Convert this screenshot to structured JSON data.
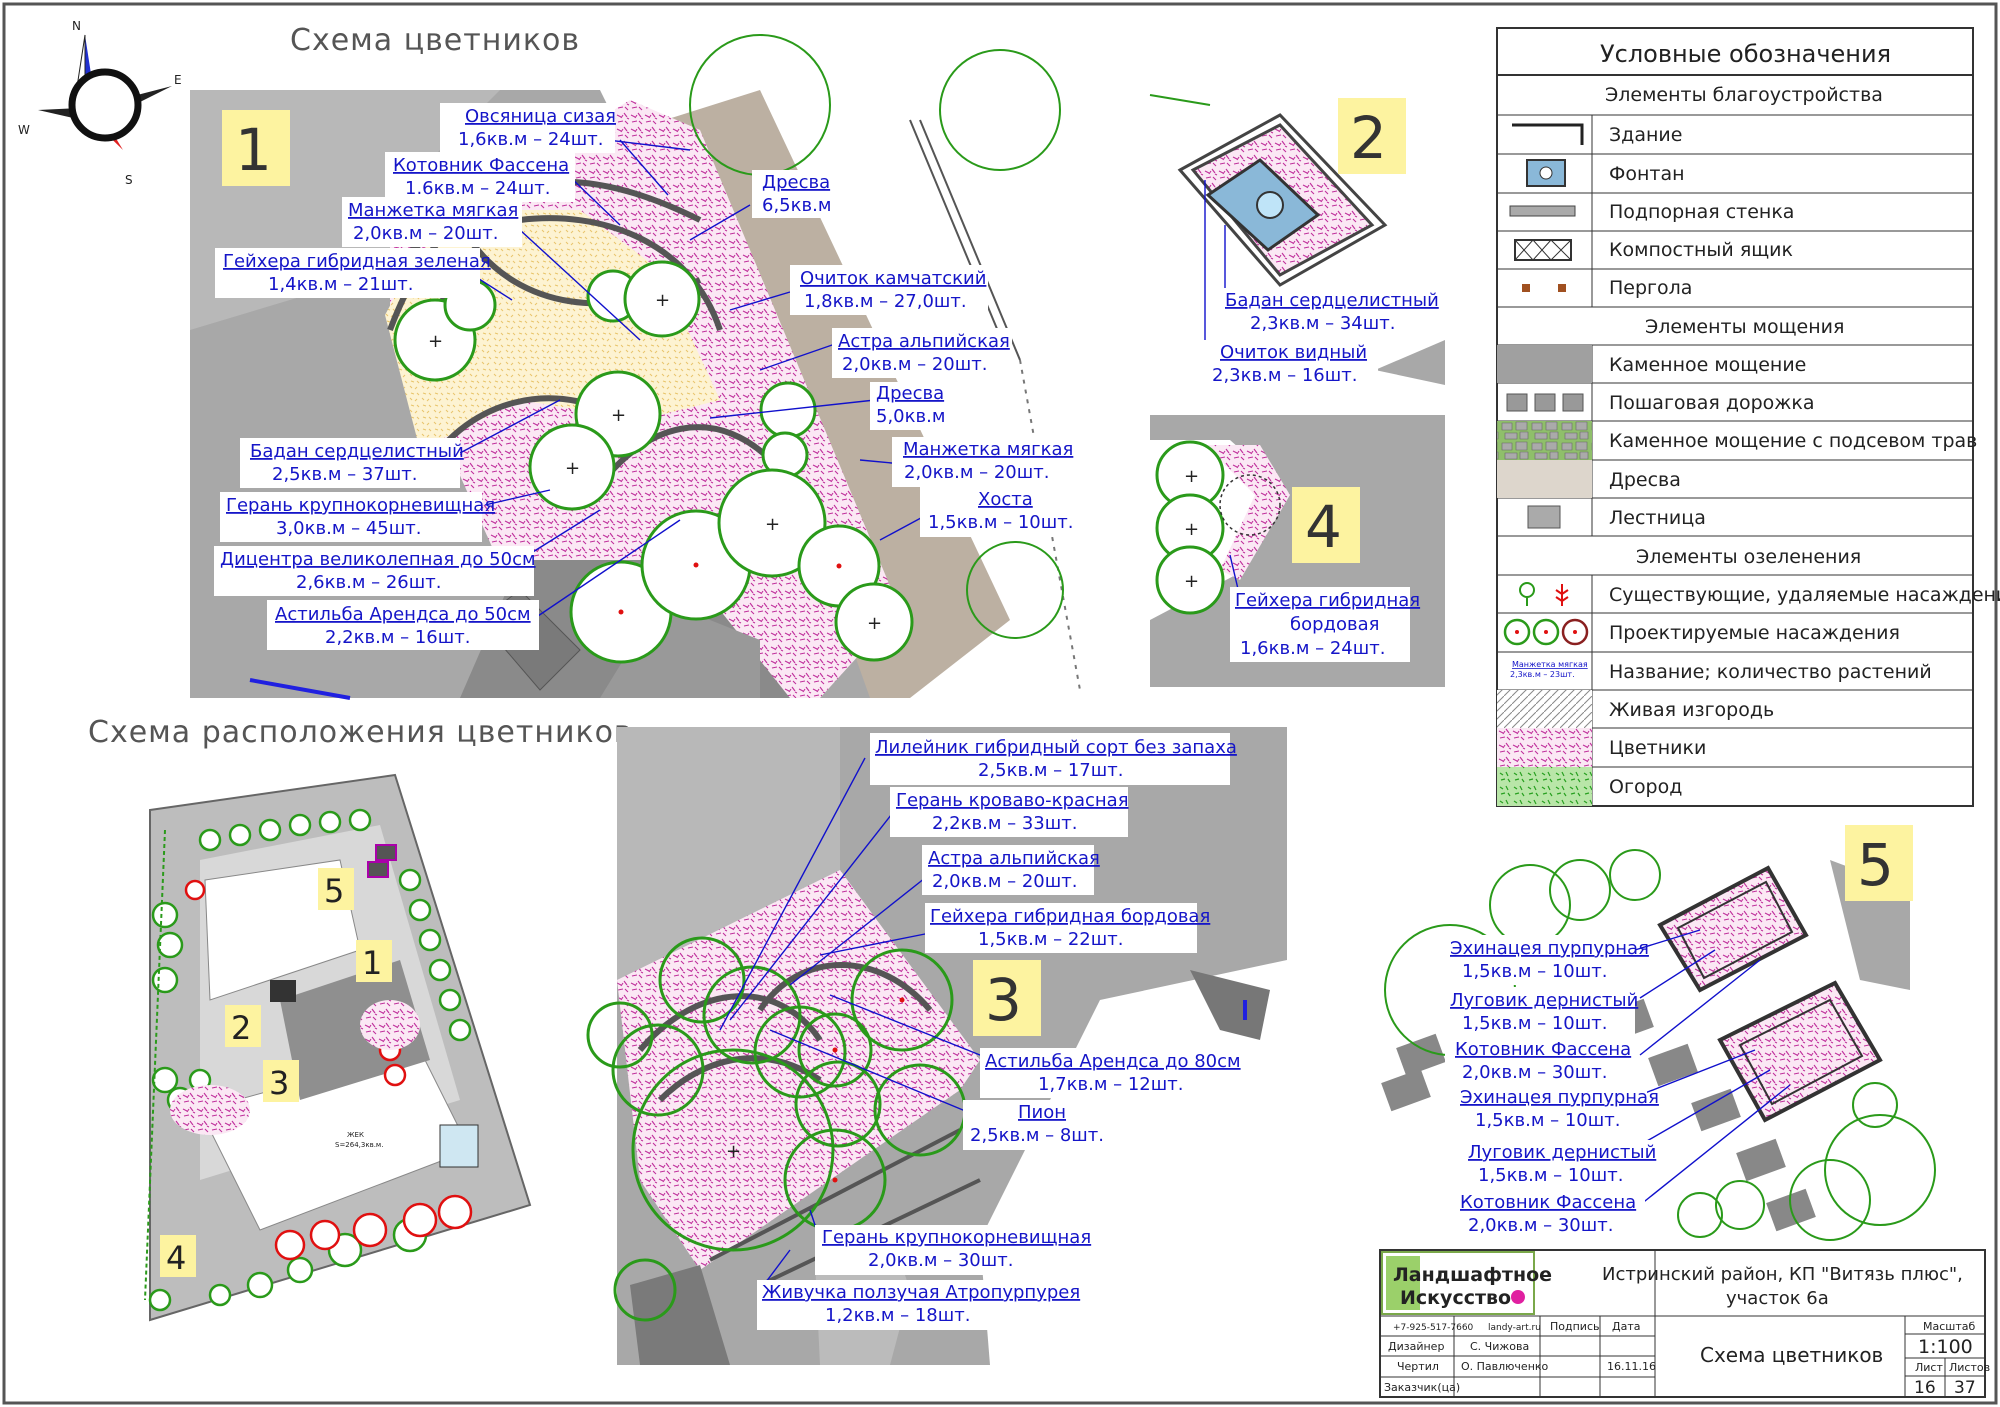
{
  "headings": {
    "scheme": "Схема цветников",
    "layout": "Схема расположения цветников"
  },
  "compass": {
    "n": "N",
    "e": "E",
    "s": "S",
    "w": "W"
  },
  "sections": [
    "1",
    "2",
    "3",
    "4",
    "5"
  ],
  "layout_numbers": [
    "5",
    "1",
    "2",
    "3",
    "4"
  ],
  "bed1_labels": [
    {
      "name": "Овсяница сизая",
      "qty": "1,6кв.м – 24шт."
    },
    {
      "name": "Котовник Фассена",
      "qty": "1.6кв.м – 24шт."
    },
    {
      "name": "Манжетка мягкая",
      "qty": "2,0кв.м – 20шт."
    },
    {
      "name": "Гейхера гибридная зеленая",
      "qty": "1,4кв.м – 21шт."
    },
    {
      "name": "Дресва",
      "qty": "6,5кв.м"
    },
    {
      "name": "Очиток камчатский",
      "qty": "1,8кв.м – 27,0шт."
    },
    {
      "name": "Астра альпийская",
      "qty": "2,0кв.м – 20шт."
    },
    {
      "name": "Дресва",
      "qty": "5,0кв.м"
    },
    {
      "name": "Бадан сердцелистный",
      "qty": "2,5кв.м – 37шт."
    },
    {
      "name": "Манжетка мягкая",
      "qty": "2,0кв.м – 20шт."
    },
    {
      "name": "Герань крупнокорневищная",
      "qty": "3,0кв.м – 45шт."
    },
    {
      "name": "Хоста",
      "qty": "1,5кв.м – 10шт."
    },
    {
      "name": "Дицентра великолепная до 50см",
      "qty": "2,6кв.м – 26шт."
    },
    {
      "name": "Астильба Арендса до 50см",
      "qty": "2,2кв.м – 16шт."
    }
  ],
  "bed2_labels": [
    {
      "name": "Бадан сердцелистный",
      "qty": "2,3кв.м – 34шт."
    },
    {
      "name": "Очиток видный",
      "qty": "2,3кв.м – 16шт."
    }
  ],
  "bed4_label": {
    "line1": "Гейхера гибридная",
    "line2": "бордовая",
    "qty": "1,6кв.м – 24шт."
  },
  "bed3_labels": [
    {
      "name": "Лилейник гибридный сорт без запаха",
      "qty": "2,5кв.м – 17шт."
    },
    {
      "name": "Герань кроваво-красная",
      "qty": "2,2кв.м – 33шт."
    },
    {
      "name": "Астра альпийская",
      "qty": "2,0кв.м – 20шт."
    },
    {
      "name": "Гейхера гибридная бордовая",
      "qty": "1,5кв.м – 22шт."
    },
    {
      "name": "Астильба Арендса до 80см",
      "qty": "1,7кв.м – 12шт."
    },
    {
      "name": "Пион",
      "qty": "2,5кв.м – 8шт."
    },
    {
      "name": "Герань крупнокорневищная",
      "qty": "2,0кв.м – 30шт."
    },
    {
      "name": "Живучка ползучая Атропурпурея",
      "qty": "1,2кв.м – 18шт."
    }
  ],
  "bed5_labels": [
    {
      "name": "Эхинацея пурпурная",
      "qty": "1,5кв.м – 10шт."
    },
    {
      "name": "Луговик дернистый",
      "qty": "1,5кв.м – 10шт."
    },
    {
      "name": "Котовник Фассена",
      "qty": "2,0кв.м – 30шт."
    },
    {
      "name": "Эхинацея пурпурная",
      "qty": "1,5кв.м – 10шт."
    },
    {
      "name": "Луговик дернистый",
      "qty": "1,5кв.м – 10шт."
    },
    {
      "name": "Котовник Фассена",
      "qty": "2,0кв.м – 30шт."
    }
  ],
  "legend": {
    "title": "Условные обозначения",
    "groups": [
      {
        "header": "Элементы благоустройства",
        "items": [
          "Здание",
          "Фонтан",
          "Подпорная стенка",
          "Компостный ящик",
          "Пергола"
        ]
      },
      {
        "header": "Элементы мощения",
        "items": [
          "Каменное мощение",
          "Пошаговая дорожка",
          "Каменное мощение с подсевом трав",
          "Дресва",
          "Лестница"
        ]
      },
      {
        "header": "Элементы озеленения",
        "items": [
          "Существующие, удаляемые насаждения",
          "Проектируемые насаждения",
          "Название; количество растений",
          "Живая изгородь",
          "Цветники",
          "Огород"
        ]
      }
    ],
    "sample_name": "Манжетка мягкая",
    "sample_qty": "2,3кв.м – 23шт."
  },
  "site_plan": {
    "building": "ЖЕК",
    "area": "S=264,3кв.м."
  },
  "title_block": {
    "logo_line1": "Ландшафтное",
    "logo_line2": "Искусство",
    "phone": "+7-925-517-7660",
    "site": "landy-art.ru",
    "signature": "Подпись",
    "date_label": "Дата",
    "project": "Истринский район, КП \"Витязь плюс\",",
    "plot": "участок 6а",
    "designer_role": "Дизайнер",
    "designer": "С. Чижова",
    "drafter_role": "Чертил",
    "drafter": "О. Павлюченко",
    "date": "16.11.16",
    "client_role": "Заказчик(ца)",
    "sheet_title": "Схема цветников",
    "scale_label": "Масштаб",
    "scale": "1:100",
    "sheet_label": "Лист",
    "sheets_label": "Листов",
    "sheet": "16",
    "sheets": "37"
  },
  "colors": {
    "label_blue": "#1515c8",
    "plant_green": "#2a9a1a",
    "bed_pink": "#cc33aa",
    "dresva": "#faf0c8",
    "paving": "#a0a0a0",
    "highlight": "#fdf3a0"
  }
}
